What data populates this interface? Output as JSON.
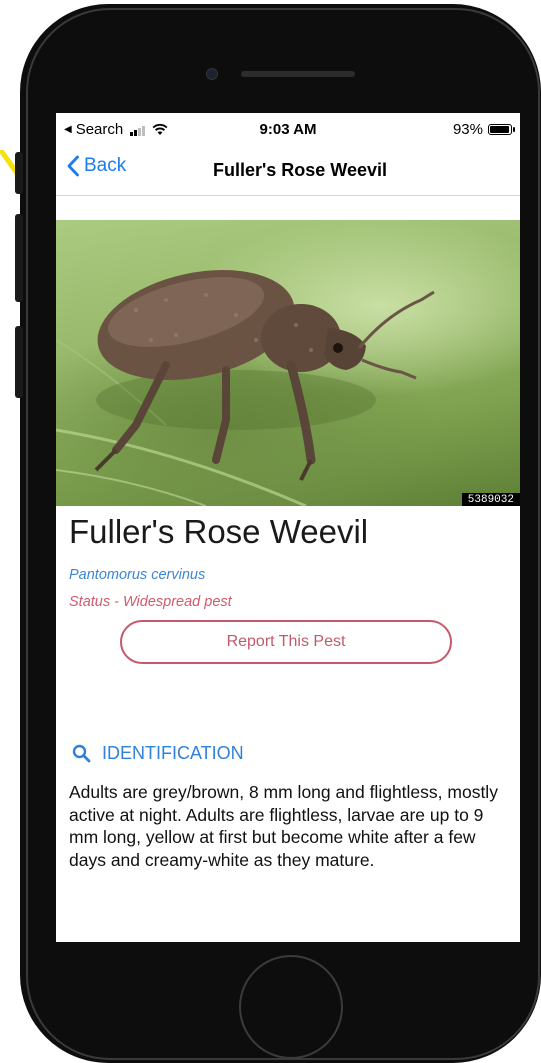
{
  "status_bar": {
    "back_app": "Search",
    "time": "9:03 AM",
    "battery": "93%",
    "battery_level": 0.93
  },
  "nav": {
    "back_label": "Back",
    "title": "Fuller's Rose Weevil"
  },
  "hero": {
    "photo_id": "5389032"
  },
  "pest": {
    "name": "Fuller's Rose Weevil",
    "scientific_name": "Pantomorus cervinus",
    "status": "Status - Widespread pest"
  },
  "actions": {
    "report_label": "Report This Pest"
  },
  "identification": {
    "header": "IDENTIFICATION",
    "icon": "search-icon",
    "text": "Adults are grey/brown, 8 mm long and flightless, mostly active at night. Adults are flightless, larvae are up to 9 mm long, yellow at first but become white after a few days and creamy-white as they mature."
  },
  "colors": {
    "ios_blue": "#1a7cf0",
    "link_blue": "#3b86d6",
    "status_pink": "#d25a6e",
    "report_border": "#c45a6c",
    "annotation_arrow": "#f5e20a"
  }
}
